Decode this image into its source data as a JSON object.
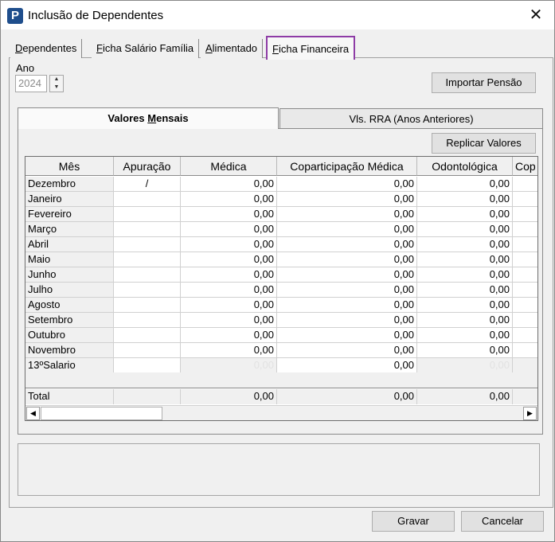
{
  "window": {
    "title": "Inclusão de Dependentes",
    "close_glyph": "✕",
    "app_icon_letter": "P"
  },
  "tabs": [
    {
      "label_u": "D",
      "label_rest": "ependentes"
    },
    {
      "label_u": "F",
      "label_rest": "icha Salário Família"
    },
    {
      "label_u": "A",
      "label_rest": "limentado"
    },
    {
      "label_u": "F",
      "label_rest": "icha Financeira",
      "active": true
    }
  ],
  "ano": {
    "label": "Ano",
    "value": "2024"
  },
  "buttons": {
    "importar": "Importar Pensão",
    "replicar": "Replicar Valores",
    "gravar": "Gravar",
    "cancelar": "Cancelar"
  },
  "inner_tabs": {
    "mensais_pre": "Valores ",
    "mensais_u": "M",
    "mensais_post": "ensais",
    "rra": "Vls. RRA (Anos Anteriores)"
  },
  "columns": [
    "Mês",
    "Apuração",
    "Médica",
    "Coparticipação Médica",
    "Odontológica",
    "Cop"
  ],
  "rows": [
    {
      "mes": "Dezembro",
      "apuracao": "/",
      "medica": "0,00",
      "copart": "0,00",
      "odonto": "0,00"
    },
    {
      "mes": "Janeiro",
      "apuracao": "",
      "medica": "0,00",
      "copart": "0,00",
      "odonto": "0,00"
    },
    {
      "mes": "Fevereiro",
      "apuracao": "",
      "medica": "0,00",
      "copart": "0,00",
      "odonto": "0,00"
    },
    {
      "mes": "Março",
      "apuracao": "",
      "medica": "0,00",
      "copart": "0,00",
      "odonto": "0,00"
    },
    {
      "mes": "Abril",
      "apuracao": "",
      "medica": "0,00",
      "copart": "0,00",
      "odonto": "0,00"
    },
    {
      "mes": "Maio",
      "apuracao": "",
      "medica": "0,00",
      "copart": "0,00",
      "odonto": "0,00"
    },
    {
      "mes": "Junho",
      "apuracao": "",
      "medica": "0,00",
      "copart": "0,00",
      "odonto": "0,00"
    },
    {
      "mes": "Julho",
      "apuracao": "",
      "medica": "0,00",
      "copart": "0,00",
      "odonto": "0,00"
    },
    {
      "mes": "Agosto",
      "apuracao": "",
      "medica": "0,00",
      "copart": "0,00",
      "odonto": "0,00"
    },
    {
      "mes": "Setembro",
      "apuracao": "",
      "medica": "0,00",
      "copart": "0,00",
      "odonto": "0,00"
    },
    {
      "mes": "Outubro",
      "apuracao": "",
      "medica": "0,00",
      "copart": "0,00",
      "odonto": "0,00"
    },
    {
      "mes": "Novembro",
      "apuracao": "",
      "medica": "0,00",
      "copart": "0,00",
      "odonto": "0,00"
    },
    {
      "mes": "13ºSalario",
      "apuracao": "",
      "medica": "0,00",
      "copart": "0,00",
      "odonto": "0,00",
      "disabled": true
    }
  ],
  "total": {
    "label": "Total",
    "medica": "0,00",
    "copart": "0,00",
    "odonto": "0,00"
  },
  "scroll": {
    "left": "◀",
    "right": "▶"
  },
  "spin": {
    "up": "▲",
    "down": "▼"
  }
}
